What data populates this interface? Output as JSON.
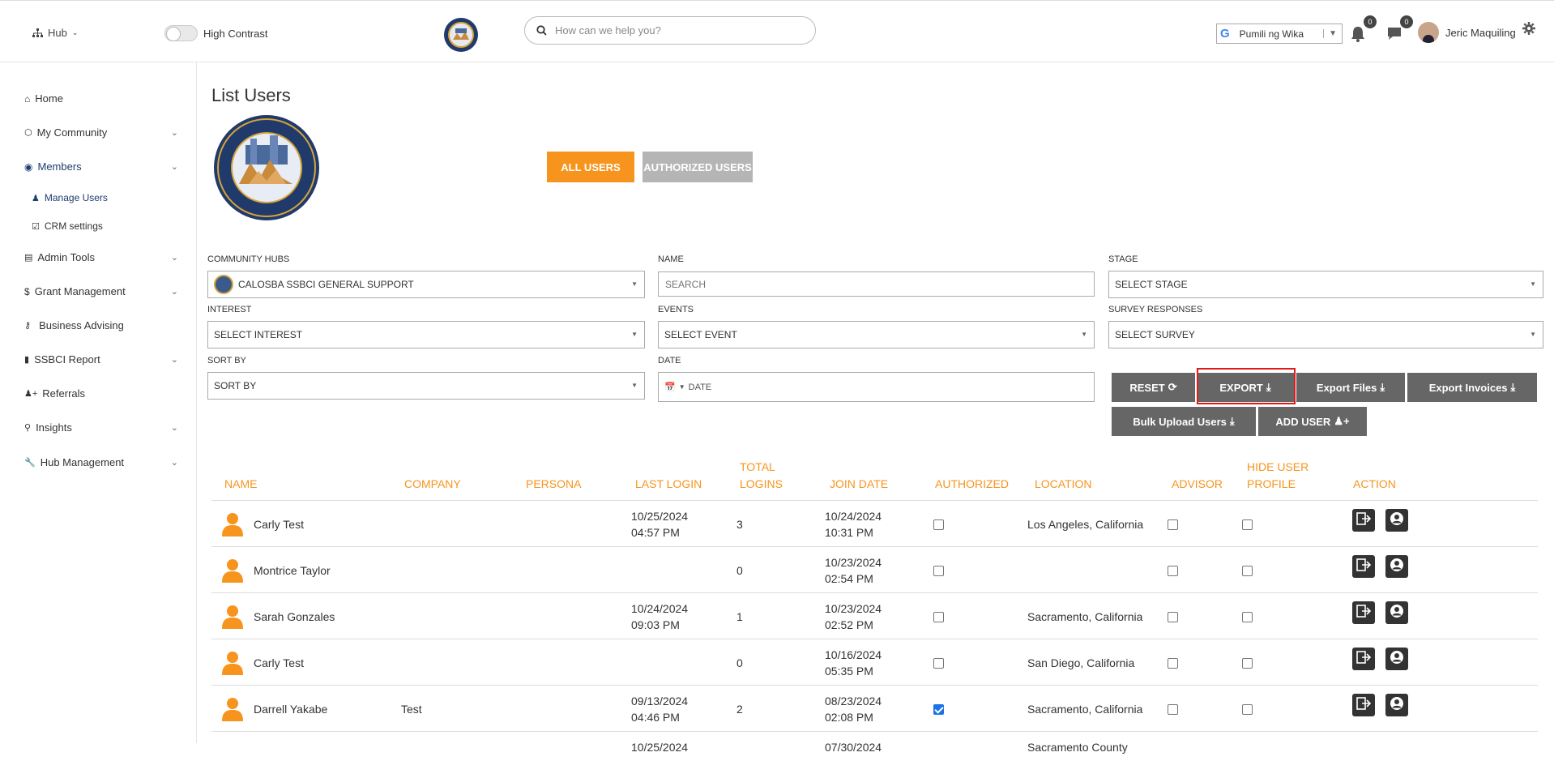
{
  "topbar": {
    "hub_label": "Hub",
    "high_contrast_label": "High Contrast",
    "search_placeholder": "How can we help you?",
    "language_label": "Pumili ng Wika",
    "notifications_count": "0",
    "messages_count": "0",
    "user_name": "Jeric Maquiling"
  },
  "sidebar": {
    "items": [
      {
        "label": "Home",
        "icon": "home-icon"
      },
      {
        "label": "My Community",
        "icon": "community-icon"
      },
      {
        "label": "Members",
        "icon": "user-circle-icon"
      },
      {
        "label": "Manage Users",
        "icon": "users-icon"
      },
      {
        "label": "CRM settings",
        "icon": "checkbox-icon"
      },
      {
        "label": "Admin Tools",
        "icon": "table-icon"
      },
      {
        "label": "Grant Management",
        "icon": "dollar-icon"
      },
      {
        "label": "Business Advising",
        "icon": "key-icon"
      },
      {
        "label": "SSBCI Report",
        "icon": "file-icon"
      },
      {
        "label": "Referrals",
        "icon": "user-plus-icon"
      },
      {
        "label": "Insights",
        "icon": "lightbulb-icon"
      },
      {
        "label": "Hub Management",
        "icon": "wrench-icon"
      }
    ]
  },
  "page": {
    "title": "List Users",
    "tab_all": "ALL USERS",
    "tab_authorized": "AUTHORIZED USERS"
  },
  "filters": {
    "community_hubs_label": "COMMUNITY HUBS",
    "community_hubs_value": "CALOSBA SSBCI GENERAL SUPPORT",
    "name_label": "NAME",
    "name_placeholder": "SEARCH",
    "stage_label": "STAGE",
    "stage_value": "SELECT STAGE",
    "interest_label": "INTEREST",
    "interest_value": "SELECT INTEREST",
    "events_label": "EVENTS",
    "events_value": "SELECT EVENT",
    "survey_label": "SURVEY RESPONSES",
    "survey_value": "SELECT SURVEY",
    "sortby_label": "SORT BY",
    "sortby_value": "SORT BY",
    "date_label": "DATE",
    "date_value": "DATE"
  },
  "buttons": {
    "reset": "RESET",
    "export": "EXPORT",
    "export_files": "Export Files",
    "export_invoices": "Export Invoices",
    "bulk_upload": "Bulk Upload Users",
    "add_user": "ADD USER"
  },
  "table": {
    "headers": {
      "name": "NAME",
      "company": "COMPANY",
      "persona": "PERSONA",
      "last_login": "LAST LOGIN",
      "total_logins_1": "TOTAL",
      "total_logins_2": "LOGINS",
      "join_date": "JOIN DATE",
      "authorized": "AUTHORIZED",
      "location": "LOCATION",
      "advisor": "ADVISOR",
      "hide_1": "HIDE USER",
      "hide_2": "PROFILE",
      "action": "ACTION"
    },
    "rows": [
      {
        "name": "Carly Test",
        "company": "",
        "last_login_date": "10/25/2024",
        "last_login_time": "04:57 PM",
        "total": "3",
        "join_date": "10/24/2024",
        "join_time": "10:31 PM",
        "authorized": false,
        "location": "Los Angeles, California"
      },
      {
        "name": "Montrice Taylor",
        "company": "",
        "last_login_date": "",
        "last_login_time": "",
        "total": "0",
        "join_date": "10/23/2024",
        "join_time": "02:54 PM",
        "authorized": false,
        "location": ""
      },
      {
        "name": "Sarah Gonzales",
        "company": "",
        "last_login_date": "10/24/2024",
        "last_login_time": "09:03 PM",
        "total": "1",
        "join_date": "10/23/2024",
        "join_time": "02:52 PM",
        "authorized": false,
        "location": "Sacramento, California"
      },
      {
        "name": "Carly Test",
        "company": "",
        "last_login_date": "",
        "last_login_time": "",
        "total": "0",
        "join_date": "10/16/2024",
        "join_time": "05:35 PM",
        "authorized": false,
        "location": "San Diego, California"
      },
      {
        "name": "Darrell Yakabe",
        "company": "Test",
        "last_login_date": "09/13/2024",
        "last_login_time": "04:46 PM",
        "total": "2",
        "join_date": "08/23/2024",
        "join_time": "02:08 PM",
        "authorized": true,
        "location": "Sacramento, California"
      }
    ],
    "partial_row": {
      "last_login_date": "10/25/2024",
      "join_date": "07/30/2024",
      "location": "Sacramento County"
    }
  },
  "colors": {
    "accent": "#f7941d",
    "button_gray": "#666666",
    "highlight": "#e01b1b",
    "nav_active": "#1c3d6e"
  }
}
